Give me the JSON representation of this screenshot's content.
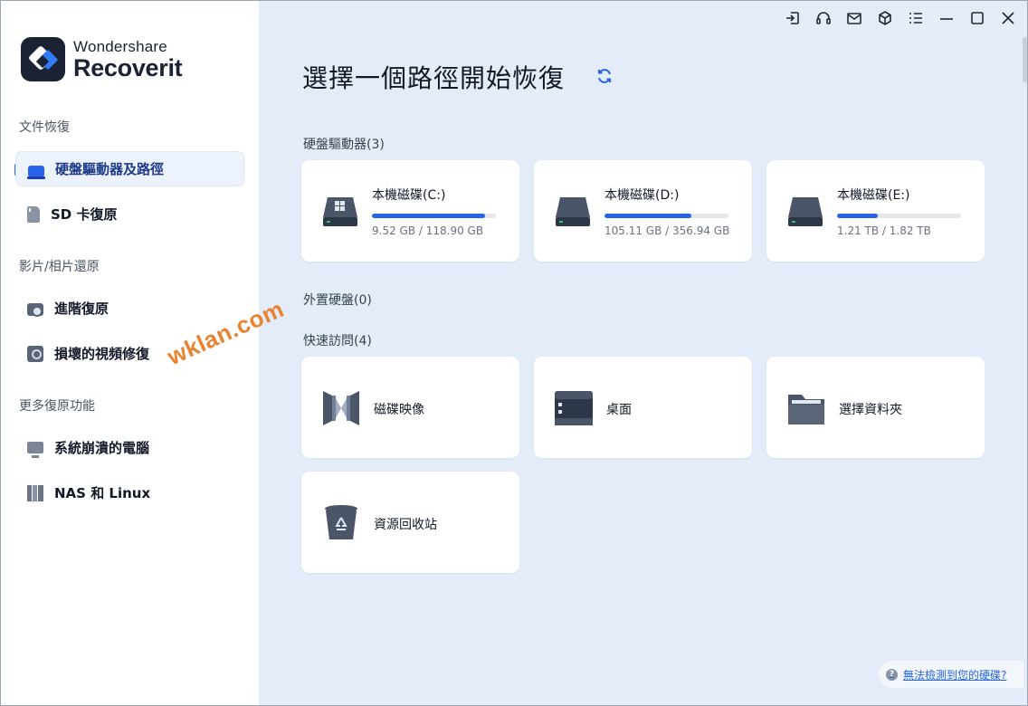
{
  "app": {
    "brand_top": "Wondershare",
    "brand_bottom": "Recoverit",
    "accent_color": "#2563eb"
  },
  "titlebar": {
    "icons": [
      "login-icon",
      "headset-icon",
      "mail-icon",
      "cube-icon",
      "menu-icon",
      "minimize-icon",
      "maximize-icon",
      "close-icon"
    ]
  },
  "sidebar": {
    "sections": [
      {
        "label": "文件恢復",
        "items": [
          {
            "label": "硬盤驅動器及路徑",
            "icon": "hard-drive-icon",
            "active": true
          },
          {
            "label": "SD 卡復原",
            "icon": "sd-card-icon",
            "active": false
          }
        ]
      },
      {
        "label": "影片/相片還原",
        "items": [
          {
            "label": "進階復原",
            "icon": "camera-icon",
            "active": false
          },
          {
            "label": "損壞的視頻修復",
            "icon": "video-repair-icon",
            "active": false
          }
        ]
      },
      {
        "label": "更多復原功能",
        "items": [
          {
            "label": "系統崩潰的電腦",
            "icon": "computer-icon",
            "active": false
          },
          {
            "label": "NAS 和 Linux",
            "icon": "nas-icon",
            "active": false
          }
        ]
      }
    ]
  },
  "main": {
    "title": "選擇一個路徑開始恢復",
    "drives_label": "硬盤驅動器(3)",
    "drives": [
      {
        "name": "本機磁碟(C:)",
        "size": "9.52 GB / 118.90 GB",
        "used_fraction": 0.91,
        "windows": true
      },
      {
        "name": "本機磁碟(D:)",
        "size": "105.11 GB / 356.94 GB",
        "used_fraction": 0.7,
        "windows": false
      },
      {
        "name": "本機磁碟(E:)",
        "size": "1.21 TB / 1.82 TB",
        "used_fraction": 0.33,
        "windows": false
      }
    ],
    "external_label": "外置硬盤(0)",
    "quick_label": "快速訪問(4)",
    "quick": [
      {
        "label": "磁碟映像",
        "icon": "disk-image-icon"
      },
      {
        "label": "桌面",
        "icon": "desktop-icon"
      },
      {
        "label": "選擇資料夾",
        "icon": "folder-icon"
      },
      {
        "label": "資源回收站",
        "icon": "recycle-bin-icon"
      }
    ],
    "help_link": "無法檢測到您的硬碟?"
  },
  "watermark": "wklan.com"
}
